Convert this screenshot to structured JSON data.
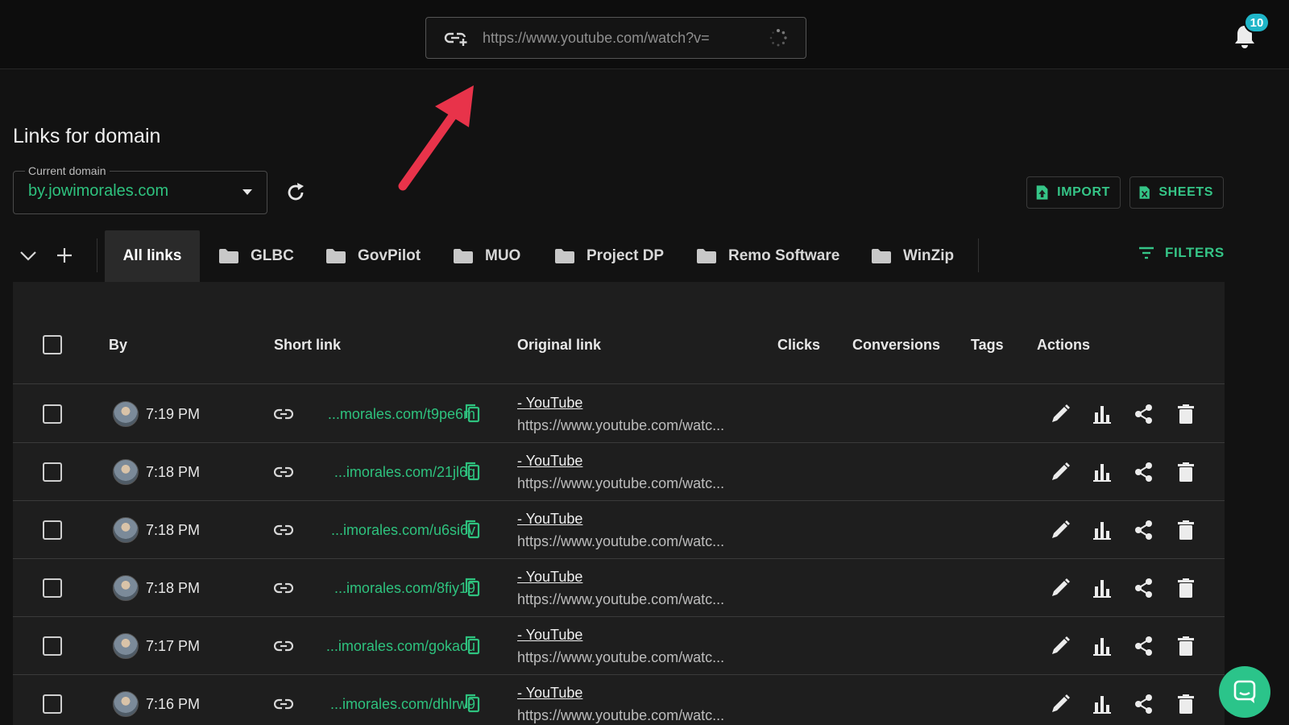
{
  "topbar": {
    "url_value": "https://www.youtube.com/watch?v=",
    "notification_count": "10"
  },
  "page": {
    "title": "Links for domain",
    "domain_label": "Current domain",
    "domain_value": "by.jowimorales.com",
    "import_label": "IMPORT",
    "sheets_label": "SHEETS",
    "filters_label": "FILTERS"
  },
  "tabs": [
    {
      "label": "All links",
      "active": true
    },
    {
      "label": "GLBC"
    },
    {
      "label": "GovPilot"
    },
    {
      "label": "MUO"
    },
    {
      "label": "Project DP"
    },
    {
      "label": "Remo Software"
    },
    {
      "label": "WinZip"
    }
  ],
  "table": {
    "headers": {
      "by": "By",
      "short": "Short link",
      "original": "Original link",
      "clicks": "Clicks",
      "conversions": "Conversions",
      "tags": "Tags",
      "actions": "Actions"
    },
    "rows": [
      {
        "time": "7:19 PM",
        "short": "...morales.com/t9pe6m",
        "orig_title": "- YouTube",
        "orig_url": "https://www.youtube.com/watc..."
      },
      {
        "time": "7:18 PM",
        "short": "...imorales.com/21jl6q",
        "orig_title": "- YouTube",
        "orig_url": "https://www.youtube.com/watc..."
      },
      {
        "time": "7:18 PM",
        "short": "...imorales.com/u6si6v",
        "orig_title": "- YouTube",
        "orig_url": "https://www.youtube.com/watc..."
      },
      {
        "time": "7:18 PM",
        "short": "...imorales.com/8fiy19",
        "orig_title": "- YouTube",
        "orig_url": "https://www.youtube.com/watc..."
      },
      {
        "time": "7:17 PM",
        "short": "...imorales.com/gokacu",
        "orig_title": "- YouTube",
        "orig_url": "https://www.youtube.com/watc..."
      },
      {
        "time": "7:16 PM",
        "short": "...imorales.com/dhlrw9",
        "orig_title": "- YouTube",
        "orig_url": "https://www.youtube.com/watc..."
      }
    ]
  },
  "colors": {
    "accent_green": "#2ec27e",
    "badge_teal": "#1fb5c8",
    "arrow_red": "#e8334a"
  },
  "icons": [
    "link-plus-icon",
    "spinner-icon",
    "bell-icon",
    "refresh-icon",
    "file-upload-icon",
    "spreadsheet-icon",
    "chevron-down-icon",
    "plus-icon",
    "folder-icon",
    "filter-icon",
    "link-icon",
    "copy-icon",
    "pencil-icon",
    "bar-chart-icon",
    "share-icon",
    "trash-icon",
    "chat-icon"
  ]
}
